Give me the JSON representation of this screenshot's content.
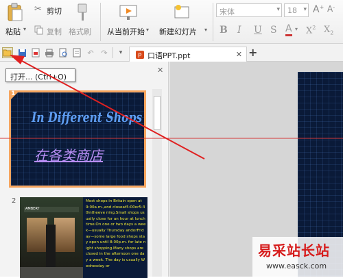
{
  "ribbon": {
    "paste": "粘贴",
    "paste_arrow": "▾",
    "cut": "剪切",
    "copy": "复制",
    "format_painter": "格式刷",
    "from_current": "从当前开始",
    "from_current_arrow": "▾",
    "new_slide": "新建幻灯片",
    "new_slide_arrow": "▾",
    "font_name": "宋体",
    "font_size": "18",
    "grow": "A",
    "grow_sup": "+",
    "shrink": "A",
    "shrink_sup": "-",
    "bold": "B",
    "italic": "I",
    "underline": "U",
    "strike": "S",
    "font_color": "A",
    "superscript": "X",
    "superscript_mark": "2",
    "subscript": "X",
    "subscript_mark": "2"
  },
  "tab": {
    "title": "口语PPT.ppt",
    "close": "✕",
    "new_tab": "+"
  },
  "tooltip": {
    "text": "打开... (Ctrl+O)"
  },
  "pane": {
    "close": "✕"
  },
  "slides": [
    {
      "number": "1",
      "title": "In Different Shops",
      "subtitle": "在各类商店"
    },
    {
      "number": "2",
      "sign": "AMBERT",
      "body": "Most shops in Britain open at 9:00a.m.,and closeat5:00or5:30intheeve ning.Small shops usually close for an hour at lunch time.On one or two days a week—usually Thursday andorFriday—some large food shops stay open until 8:00p.m. for late night shopping.Many shops are closed in the afternoon one day a week. The day is usually Wednesday or"
    }
  ],
  "watermark": {
    "name": "易采站长站",
    "url": "www.easck.com"
  },
  "colors": {
    "accent_arrow": "#e02020",
    "slide_bg": "#0a1a38",
    "title_text": "#5e9df2",
    "subtitle_text": "#b98ef5",
    "body_text": "#f3ea33",
    "selected_border": "#f6a55e",
    "slide_number_badge": "#f6a55e"
  }
}
